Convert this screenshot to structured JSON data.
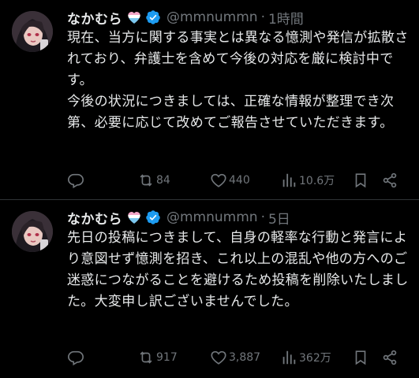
{
  "colors": {
    "background": "#000000",
    "text": "#e7e9ea",
    "muted": "#71767b",
    "verified": "#1d9bf0",
    "divider": "#2f3336"
  },
  "tweets": [
    {
      "display_name": "なかむら",
      "handle": "@mmnummn",
      "separator": "·",
      "time": "1時間",
      "text": "現在、当方に関する事実とは異なる憶測や発信が拡散されており、弁護士を含めて今後の対応を厳に検討中です。\n今後の状況につきましては、正確な情報が整理でき次第、必要に応じて改めてご報告させていただきます。",
      "retweets": "84",
      "likes": "440",
      "views": "10.6万",
      "icons": [
        "reply-icon",
        "retweet-icon",
        "like-icon",
        "views-icon",
        "bookmark-icon",
        "share-icon"
      ]
    },
    {
      "display_name": "なかむら",
      "handle": "@mmnummn",
      "separator": "·",
      "time": "5日",
      "text": "先日の投稿につきまして、自身の軽率な行動と発言により意図せず憶測を招き、これ以上の混乱や他の方へのご迷惑につながることを避けるため投稿を削除いたしました。大変申し訳ございませんでした。",
      "retweets": "917",
      "likes": "3,887",
      "views": "362万",
      "icons": [
        "reply-icon",
        "retweet-icon",
        "like-icon",
        "views-icon",
        "bookmark-icon",
        "share-icon"
      ]
    }
  ]
}
